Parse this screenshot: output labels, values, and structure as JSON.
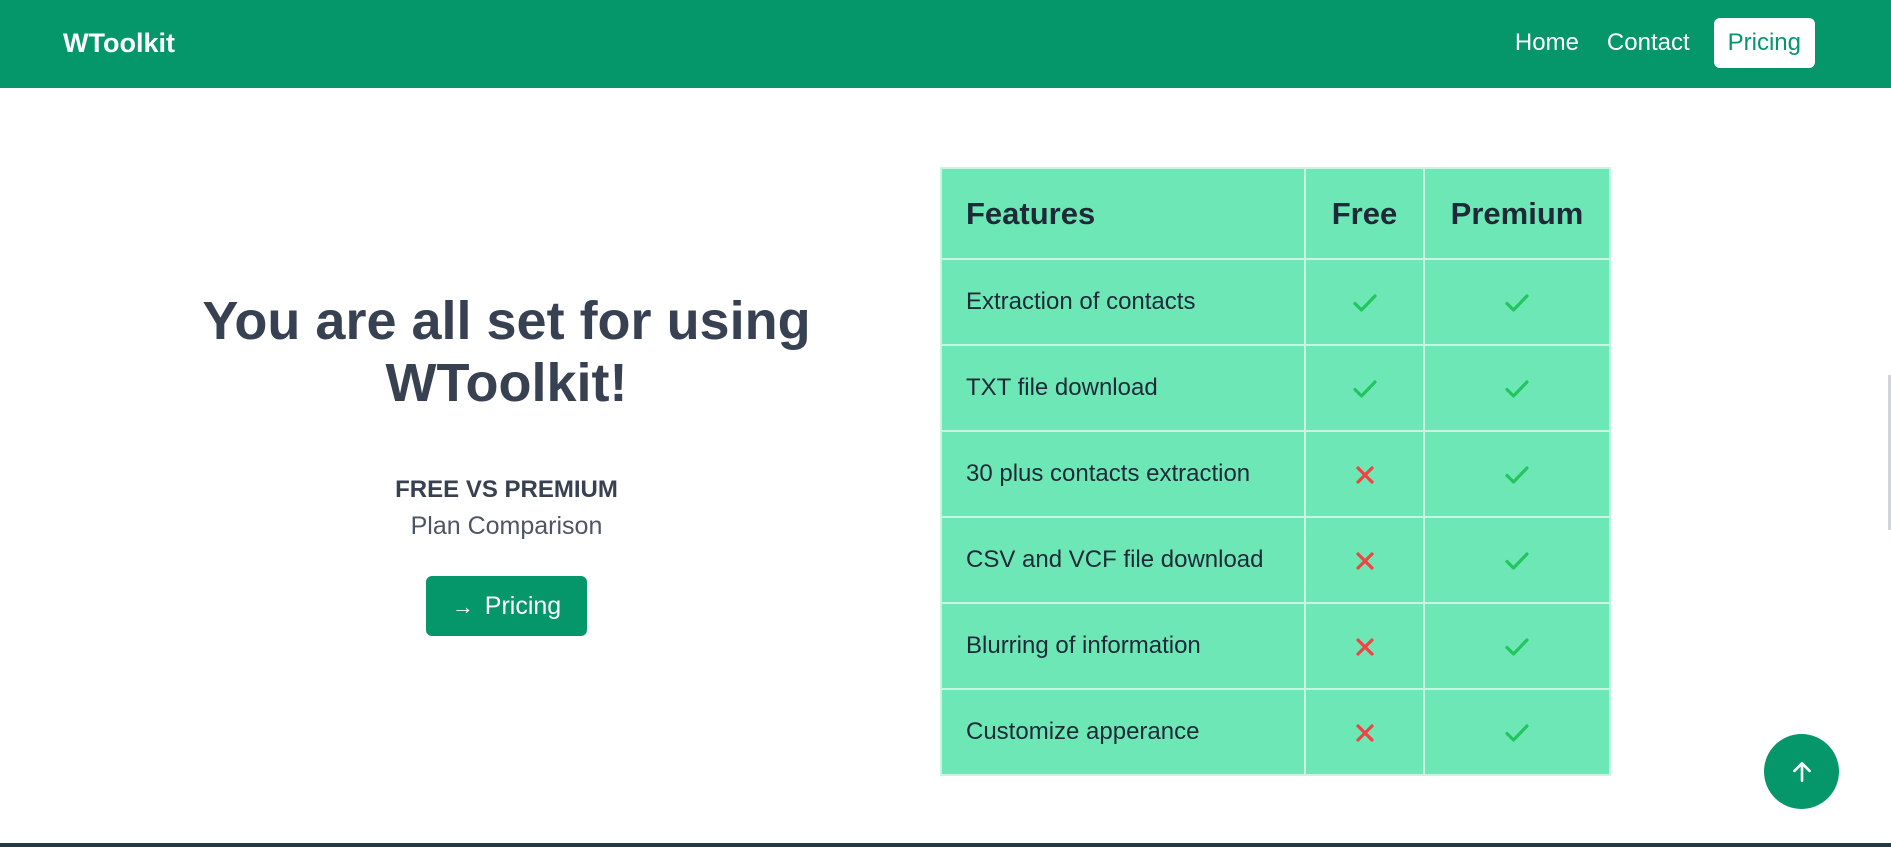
{
  "navbar": {
    "brand": "WToolkit",
    "links": [
      {
        "label": "Home"
      },
      {
        "label": "Contact"
      },
      {
        "label": "Pricing",
        "active": true
      }
    ],
    "background": "#059669"
  },
  "hero": {
    "title_line1": "You are all set for using",
    "title_line2": "WToolkit!",
    "subtitle": "FREE VS PREMIUM",
    "subtitle2": "Plan Comparison",
    "cta_arrow": "→",
    "cta_label": "Pricing"
  },
  "comparison": {
    "headers": [
      "Features",
      "Free",
      "Premium"
    ],
    "rows": [
      {
        "feature": "Extraction of contacts",
        "free": "check",
        "premium": "check"
      },
      {
        "feature": "TXT file download",
        "free": "check",
        "premium": "check"
      },
      {
        "feature": "30 plus contacts extraction",
        "free": "cross",
        "premium": "check"
      },
      {
        "feature": "CSV and VCF file download",
        "free": "cross",
        "premium": "check"
      },
      {
        "feature": "Blurring of information",
        "free": "cross",
        "premium": "check"
      },
      {
        "feature": "Customize apperance",
        "free": "cross",
        "premium": "check"
      }
    ],
    "colors": {
      "table_bg": "#6ee7b7",
      "check": "#22c55e",
      "cross": "#ef4444"
    }
  },
  "scroll_top": {
    "icon": "arrow-up-icon"
  },
  "colors": {
    "accent": "#059669",
    "text": "#374151"
  }
}
